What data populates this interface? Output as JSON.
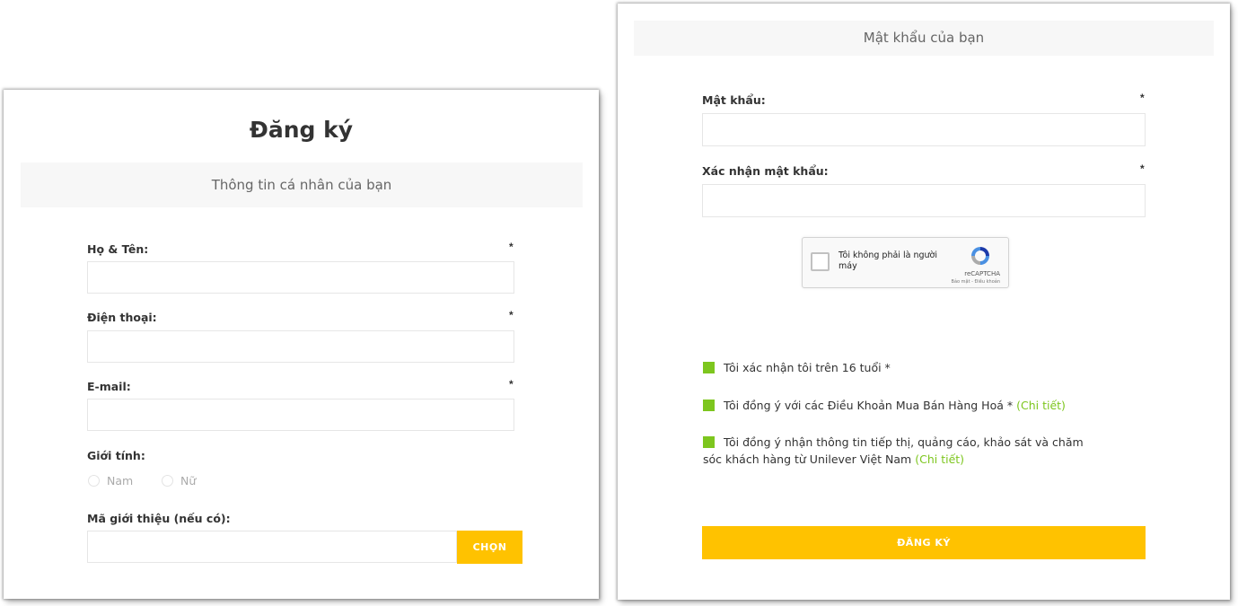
{
  "left": {
    "title": "Đăng ký",
    "section": "Thông tin cá nhân của bạn",
    "fields": [
      {
        "label": "Họ & Tên:",
        "required": "*",
        "value": "",
        "placeholder": ""
      },
      {
        "label": "Điện thoại:",
        "required": "*",
        "value": "",
        "placeholder": ""
      },
      {
        "label": "E-mail:",
        "required": "*",
        "value": "",
        "placeholder": ""
      }
    ],
    "gender": {
      "label": "Giới tính:",
      "options": [
        "Nam",
        "Nữ"
      ]
    },
    "referral": {
      "label": "Mã giới thiệu (nếu có):",
      "value": "",
      "button": "CHỌN"
    }
  },
  "right": {
    "section": "Mật khẩu của bạn",
    "fields": [
      {
        "label": "Mật khẩu:",
        "required": "*",
        "value": ""
      },
      {
        "label": "Xác nhận mật khẩu:",
        "required": "*",
        "value": ""
      }
    ],
    "captcha": {
      "text": "Tôi không phải là người máy",
      "brand": "reCAPTCHA",
      "links": "Bảo mật - Điều khoản"
    },
    "consents": [
      {
        "text": "Tôi xác nhận tôi trên 16 tuổi *",
        "link": ""
      },
      {
        "text": "Tôi đồng ý với các Điều Khoản Mua Bán Hàng Hoá *",
        "link": "(Chi tiết)"
      },
      {
        "text": "Tôi đồng ý nhận thông tin tiếp thị, quảng cáo, khảo sát và chăm sóc khách hàng từ Unilever Việt Nam",
        "link": "(Chi tiết)"
      }
    ],
    "submit": "ĐĂNG KÝ"
  },
  "colors": {
    "accent_yellow": "#ffc200",
    "check_green": "#7dc61e",
    "section_bg": "#f7f7f7"
  },
  "icons": [
    "recaptcha-logo-icon"
  ]
}
